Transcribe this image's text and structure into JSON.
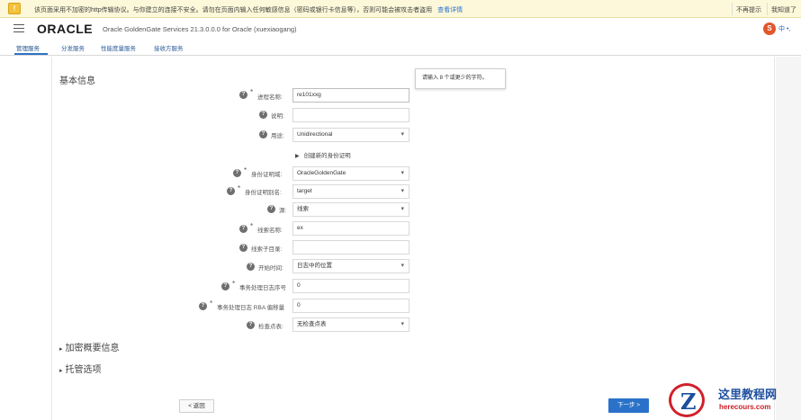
{
  "warning": {
    "text": "该页面采用不加密的http传输协议。与你建立的连接不安全。请勿在页面内输入任何敏感信息（密码或银行卡信息等），否则可能会被攻击者盗用",
    "link": "查看详情",
    "dont_remind": "不再提示",
    "got_it": "我知道了"
  },
  "header": {
    "logo": "ORACLE",
    "app_title": "Oracle GoldenGate Services 21.3.0.0.0 for Oracle (xuexiaogang)",
    "ime_label": "中 •, "
  },
  "nav": {
    "tabs": [
      "管理服务",
      "分发服务",
      "性能度量服务",
      "接收方服务"
    ]
  },
  "form": {
    "section_title": "基本信息",
    "tooltip": "请输入 8 个或更少的字符。",
    "fields": {
      "process_name": {
        "label": "进程名称:",
        "value": "re101xxg"
      },
      "description": {
        "label": "说明:",
        "value": ""
      },
      "purpose": {
        "label": "用途:",
        "value": "Unidirectional"
      },
      "create_credential": "创建新的身份证明",
      "credential_domain": {
        "label": "身份证明域:",
        "value": "OracleGoldenGate"
      },
      "credential_alias": {
        "label": "身份证明别名:",
        "value": "target"
      },
      "source": {
        "label": "源:",
        "value": "线索"
      },
      "trail_name": {
        "label": "线索名称:",
        "value": "ex"
      },
      "trail_subdir": {
        "label": "线索子目录:",
        "value": ""
      },
      "begin": {
        "label": "开始时间:",
        "value": "日志中的位置"
      },
      "seqno": {
        "label": "事务处理日志序号",
        "value": "0"
      },
      "rba": {
        "label": "事务处理日志 RBA 偏移量",
        "value": "0"
      },
      "checkpoint": {
        "label": "检查点表:",
        "value": "无检查点表"
      }
    },
    "encryption_section": "加密概要信息",
    "managed_section": "托管选项"
  },
  "buttons": {
    "back": "返回",
    "next": "下一步"
  },
  "watermark": {
    "cn": "这里教程网",
    "url": "herecours.com"
  },
  "colors": {
    "accent": "#2a72c9",
    "warning_bg": "#fdf8d9"
  }
}
